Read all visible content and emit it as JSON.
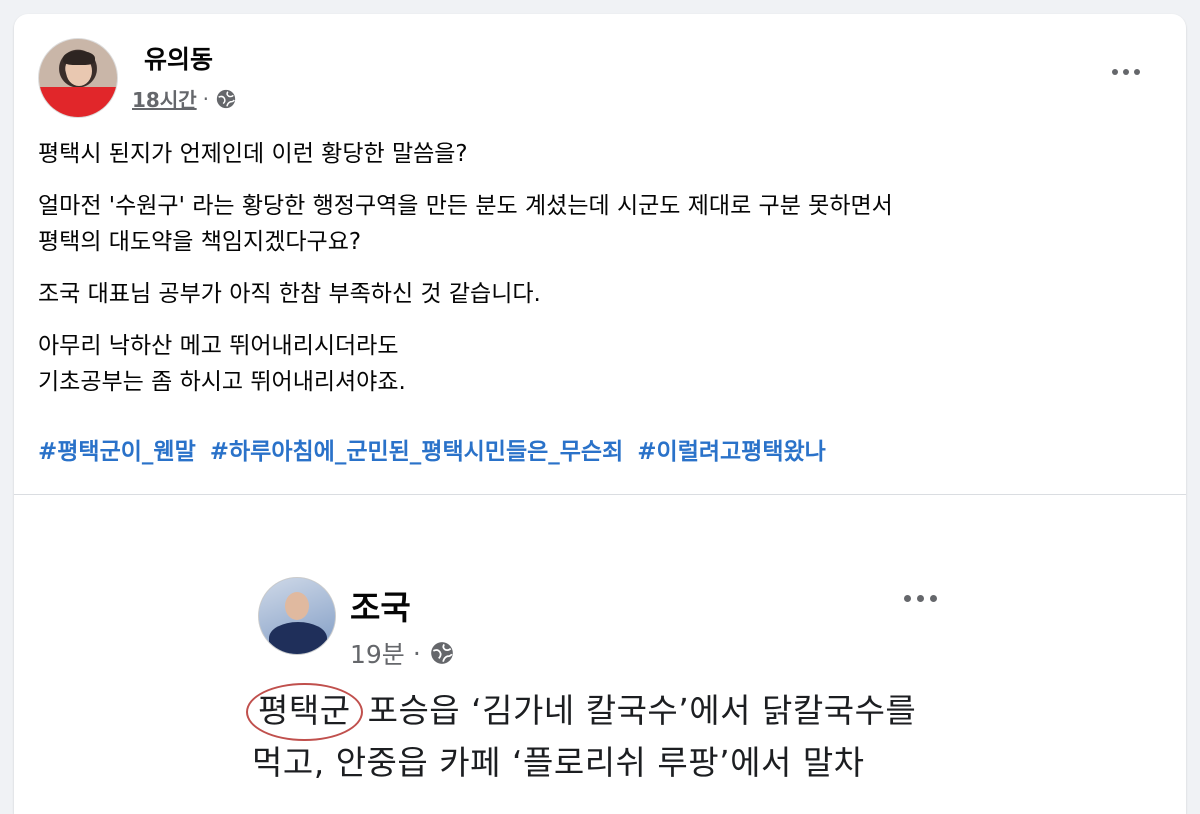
{
  "post": {
    "author": "유의동",
    "time": "18시간",
    "separator": "·",
    "paragraphs": [
      "평택시 된지가 언제인데 이런 황당한 말씀을?",
      "얼마전 '수원구' 라는 황당한 행정구역을 만든 분도 계셨는데 시군도 제대로 구분 못하면서\n평택의 대도약을 책임지겠다구요?",
      "조국 대표님 공부가 아직 한참 부족하신 것 같습니다.",
      "아무리 낙하산 메고 뛰어내리시더라도\n기초공부는 좀 하시고 뛰어내리셔야죠."
    ],
    "hashtags": [
      "#평택군이_웬말",
      "#하루아침에_군민된_평택시민들은_무슨죄",
      "#이럴려고평택왔나"
    ],
    "icons": {
      "audience": "globe-icon",
      "menu": "more-options-icon"
    }
  },
  "shared": {
    "author": "조국",
    "time": "19분",
    "separator": "·",
    "circled_word": "평택군",
    "line1_rest": " 포승읍 ‘김가네 칼국수’에서 닭칼국수를",
    "line2": "먹고, 안중읍 카페 ‘플로리쉬 루팡’에서 말차"
  },
  "colors": {
    "hashtag": "#2a72c9",
    "meta": "#65676b",
    "circle": "#c0504d",
    "background": "#f0f2f5"
  }
}
